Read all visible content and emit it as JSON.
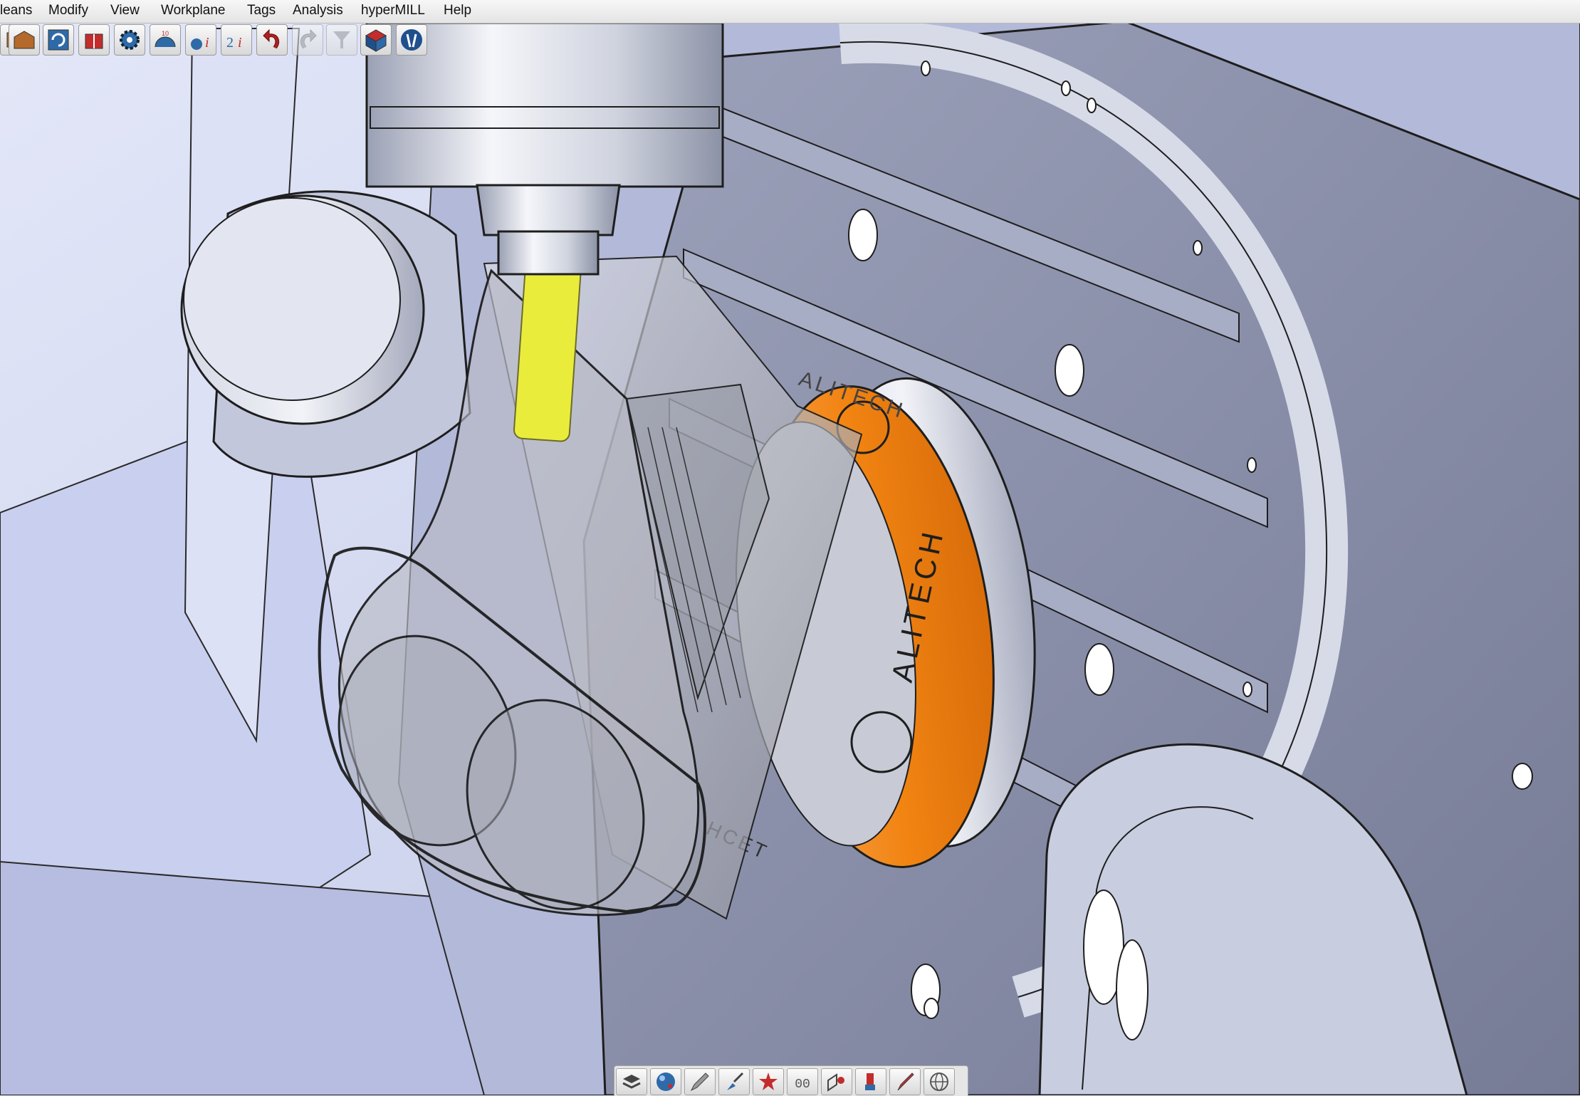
{
  "menubar": {
    "items": [
      "leans",
      "Modify",
      "View",
      "Workplane",
      "Tags",
      "Analysis",
      "hyperMILL",
      "Help"
    ]
  },
  "toolbar": {
    "buttons": [
      "stock-icon",
      "open-box-icon",
      "spiral-icon",
      "gift-icon",
      "gear-icon",
      "gauge-icon",
      "info-icon",
      "info-2i-icon",
      "undo-icon",
      "redo-icon",
      "filter-icon",
      "cube-icon",
      "hypermill-logo-icon"
    ]
  },
  "bottom_toolbar": {
    "buttons": [
      "layers-icon",
      "globe-icon",
      "pencil-icon",
      "brush-icon",
      "star-icon",
      "grid-00-icon",
      "shape-icon",
      "paint-icon",
      "marker-icon",
      "wireframe-icon"
    ],
    "grid_label": "00"
  },
  "scene": {
    "ring_text_main": "ALITECH",
    "ring_text_top": "ALITECH",
    "ring_text_bottom": "HCET",
    "colors": {
      "background": "#cfd6f2",
      "machine": "#8e93ad",
      "ring": "#f28a1c",
      "tool": "#e9ec3a"
    }
  }
}
